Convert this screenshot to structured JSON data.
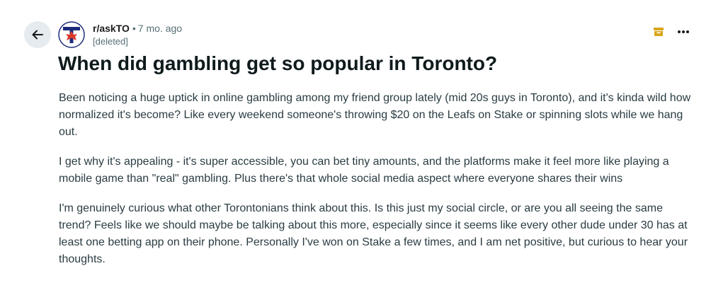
{
  "post": {
    "subreddit": "r/askTO",
    "separator": "•",
    "time_ago": "7 mo. ago",
    "author": "[deleted]",
    "title": "When did gambling get so popular in Toronto?",
    "paragraphs": [
      "Been noticing a huge uptick in online gambling among my friend group lately (mid 20s guys in Toronto), and it's kinda wild how normalized it's become? Like every weekend someone's throwing $20 on the Leafs on Stake or spinning slots while we hang out.",
      "I get why it's appealing - it's super accessible, you can bet tiny amounts, and the platforms make it feel more like playing a mobile game than \"real\" gambling. Plus there's that whole social media aspect where everyone shares their wins",
      "I'm genuinely curious what other Torontonians think about this. Is this just my social circle, or are you all seeing the same trend? Feels like we should maybe be talking about this more, especially since it seems like every other dude under 30 has at least one betting app on their phone. Personally I've won on Stake a few times, and I am net positive, but curious to hear your thoughts."
    ]
  },
  "icons": {
    "back": "back-arrow-icon",
    "avatar": "subreddit-avatar",
    "archive": "archive-icon",
    "more": "more-options-icon"
  },
  "colors": {
    "back_button_bg": "#e5ebee",
    "archive_icon": "#d9a51c",
    "avatar_red": "#d93a2b",
    "avatar_navy": "#1d2a7a",
    "meta_gray": "#576f76"
  }
}
